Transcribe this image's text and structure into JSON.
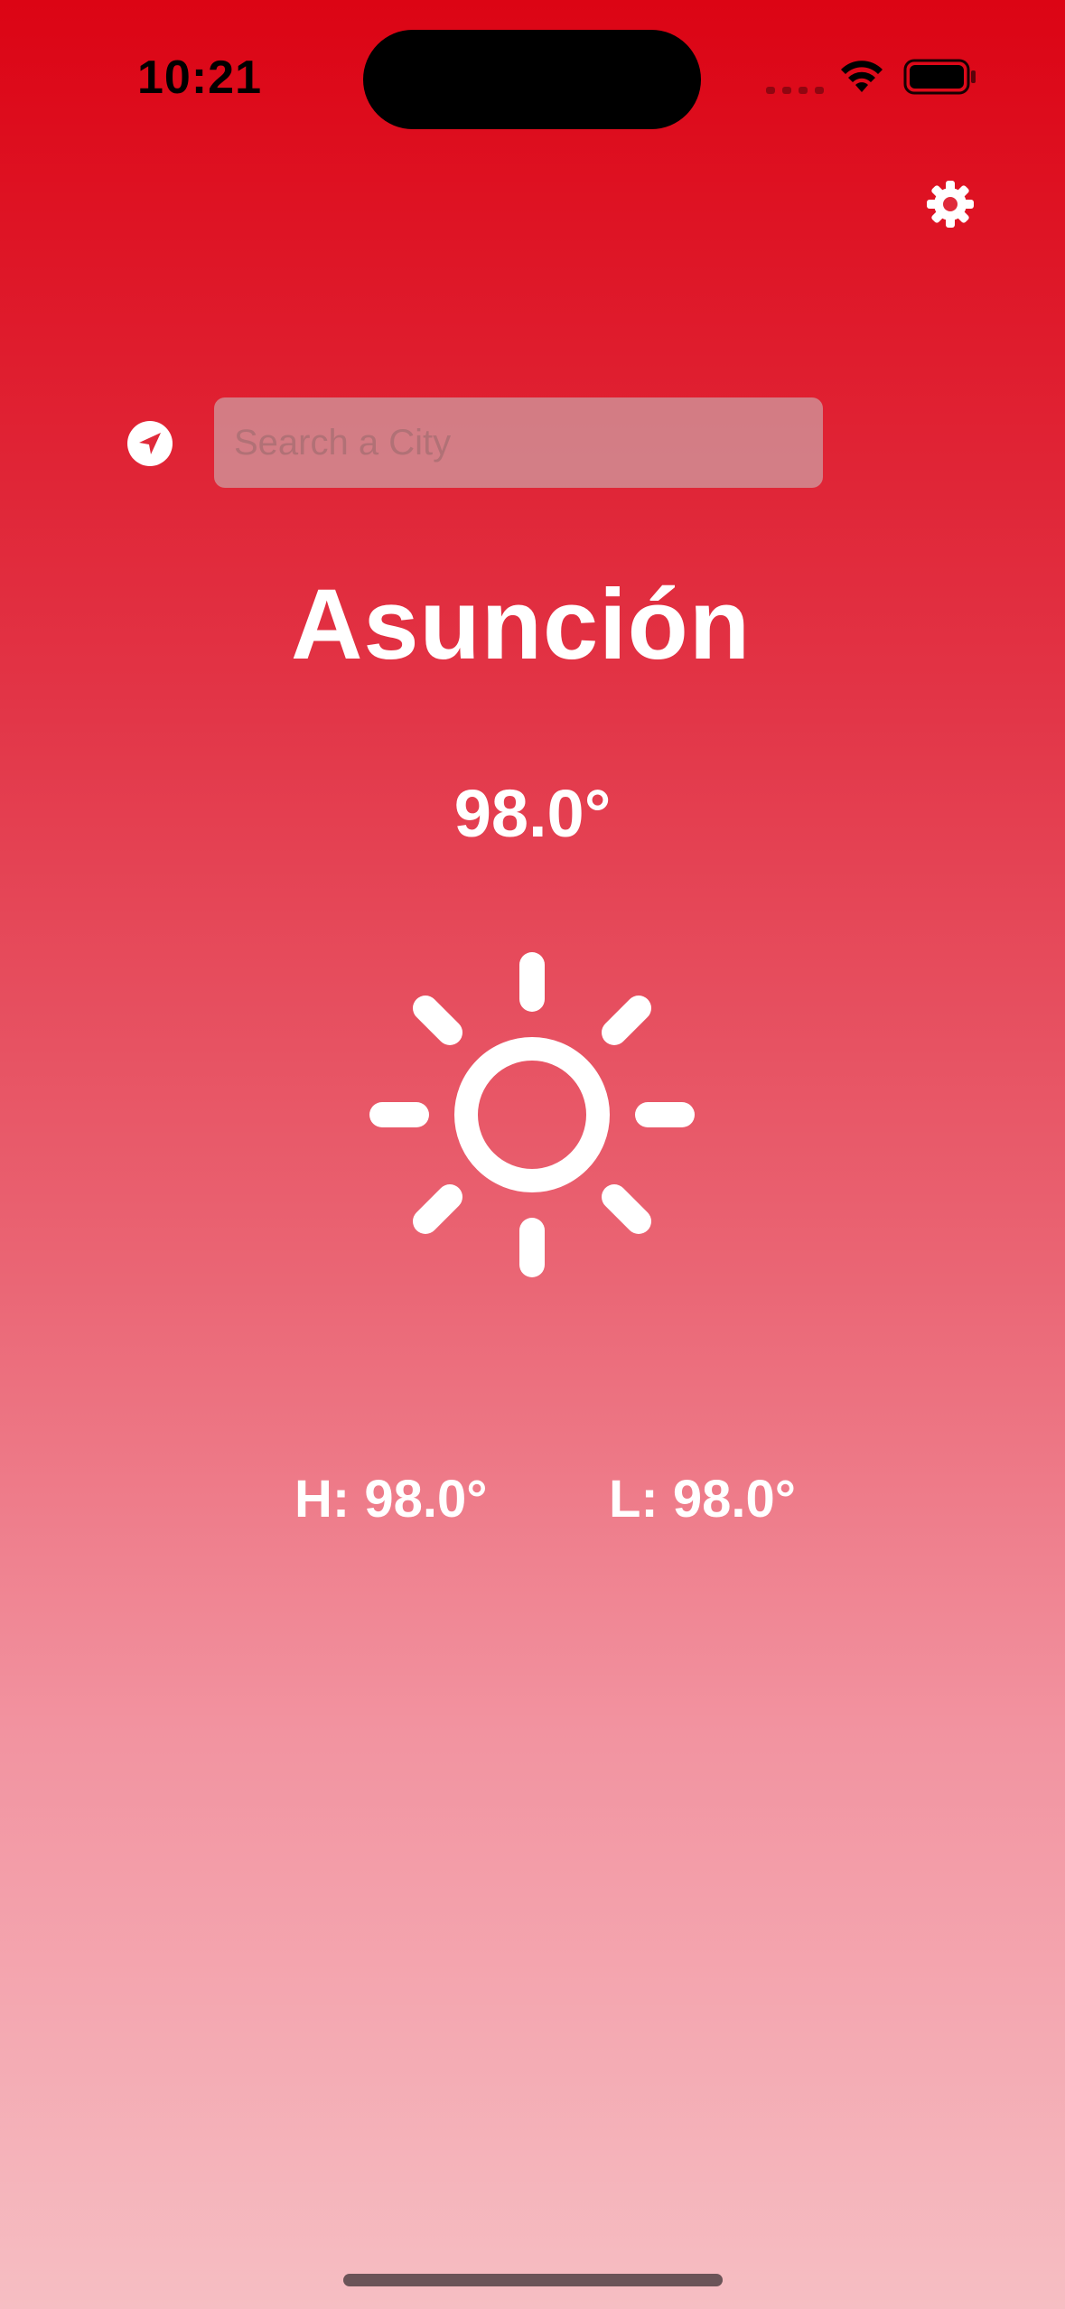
{
  "status_bar": {
    "time": "10:21"
  },
  "icons": {
    "settings": "gear-icon",
    "location": "location-arrow-icon",
    "weather": "sun-icon",
    "wifi": "wifi-icon",
    "battery": "battery-icon"
  },
  "search": {
    "placeholder": "Search a City",
    "value": ""
  },
  "weather": {
    "city": "Asunción",
    "temperature": "98.0°",
    "high": "H: 98.0°",
    "low": "L: 98.0°"
  },
  "colors": {
    "gradient_top": "#dc0414",
    "gradient_bottom": "#f6bec3",
    "text": "#ffffff"
  }
}
